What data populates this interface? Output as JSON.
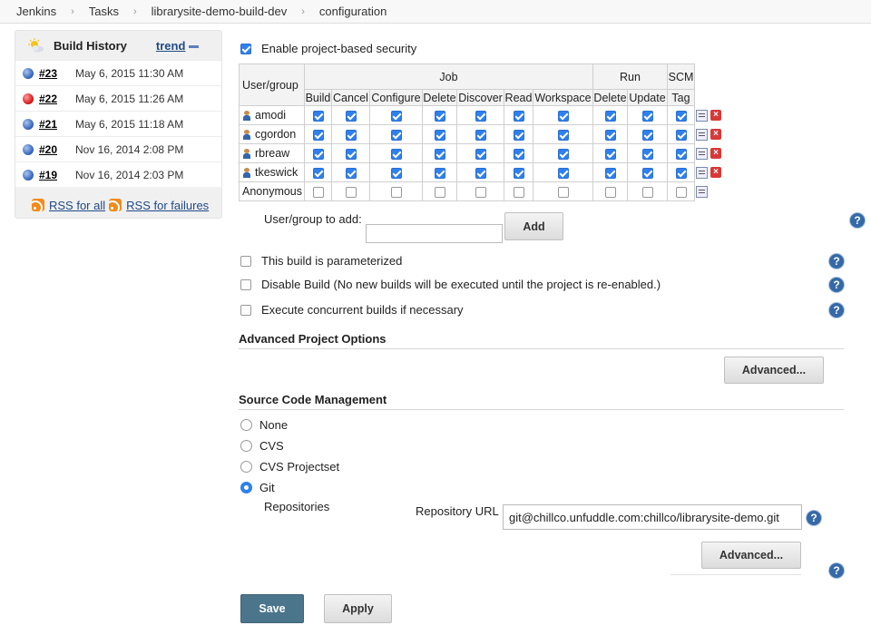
{
  "breadcrumb": [
    "Jenkins",
    "Tasks",
    "librarysite-demo-build-dev",
    "configuration"
  ],
  "build_history": {
    "title": "Build History",
    "trend_label": "trend",
    "builds": [
      {
        "number": "#23",
        "date": "May 6, 2015 11:30 AM",
        "status": "blue"
      },
      {
        "number": "#22",
        "date": "May 6, 2015 11:26 AM",
        "status": "red"
      },
      {
        "number": "#21",
        "date": "May 6, 2015 11:18 AM",
        "status": "blue"
      },
      {
        "number": "#20",
        "date": "Nov 16, 2014 2:08 PM",
        "status": "blue"
      },
      {
        "number": "#19",
        "date": "Nov 16, 2014 2:03 PM",
        "status": "blue"
      }
    ],
    "rss_all": "RSS for all",
    "rss_failures": "RSS for failures"
  },
  "security": {
    "enable_label": "Enable project-based security",
    "enabled": true,
    "header_usergroup": "User/group",
    "groups": [
      "Job",
      "Run",
      "SCM"
    ],
    "columns": [
      "Build",
      "Cancel",
      "Configure",
      "Delete",
      "Discover",
      "Read",
      "Workspace",
      "Delete",
      "Update",
      "Tag"
    ],
    "rows": [
      {
        "name": "amodi",
        "user": true,
        "checked": [
          true,
          true,
          true,
          true,
          true,
          true,
          true,
          true,
          true,
          true
        ]
      },
      {
        "name": "cgordon",
        "user": true,
        "checked": [
          true,
          true,
          true,
          true,
          true,
          true,
          true,
          true,
          true,
          true
        ]
      },
      {
        "name": "rbreaw",
        "user": true,
        "checked": [
          true,
          true,
          true,
          true,
          true,
          true,
          true,
          true,
          true,
          true
        ]
      },
      {
        "name": "tkeswick",
        "user": true,
        "checked": [
          true,
          true,
          true,
          true,
          true,
          true,
          true,
          true,
          true,
          true
        ]
      },
      {
        "name": "Anonymous",
        "user": false,
        "checked": [
          false,
          false,
          false,
          false,
          false,
          false,
          false,
          false,
          false,
          false
        ]
      }
    ],
    "add_label": "User/group to add:",
    "add_value": "",
    "add_button": "Add"
  },
  "options": {
    "parameterized": "This build is parameterized",
    "disable": "Disable Build (No new builds will be executed until the project is re-enabled.)",
    "concurrent": "Execute concurrent builds if necessary"
  },
  "advanced_project": {
    "title": "Advanced Project Options",
    "button": "Advanced..."
  },
  "scm": {
    "title": "Source Code Management",
    "choices": [
      "None",
      "CVS",
      "CVS Projectset",
      "Git"
    ],
    "selected": "Git",
    "repositories_label": "Repositories",
    "repo_url_label": "Repository URL",
    "repo_url_value": "git@chillco.unfuddle.com:chillco/librarysite-demo.git",
    "advanced_button": "Advanced..."
  },
  "footer": {
    "save": "Save",
    "apply": "Apply"
  },
  "help_glyph": "?"
}
